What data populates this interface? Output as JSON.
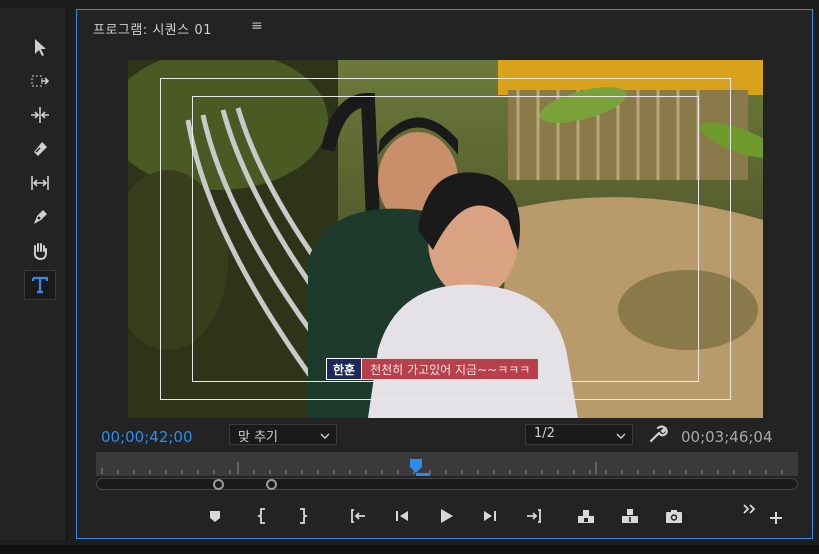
{
  "panel": {
    "title": "프로그램: 시퀀스 01",
    "menu_icon": "hamburger-icon"
  },
  "tools": [
    {
      "name": "selection-tool",
      "icon": "arrow-icon"
    },
    {
      "name": "track-select-tool",
      "icon": "track-select-icon"
    },
    {
      "name": "ripple-edit-tool",
      "icon": "ripple-edit-icon"
    },
    {
      "name": "razor-tool",
      "icon": "razor-icon"
    },
    {
      "name": "slip-tool",
      "icon": "slip-icon"
    },
    {
      "name": "pen-tool",
      "icon": "pen-icon"
    },
    {
      "name": "hand-tool",
      "icon": "hand-icon"
    },
    {
      "name": "type-tool",
      "icon": "type-icon",
      "active": true
    }
  ],
  "video": {
    "caption_name": "한훈",
    "caption_text": "천천히 가고있어 지금~~ㅋㅋㅋ"
  },
  "controls": {
    "current_timecode": "00;00;42;00",
    "zoom_select": "맞 추기",
    "resolution_select": "1/2",
    "duration_timecode": "00;03;46;04",
    "wrench_icon": "wrench-icon"
  },
  "transport": [
    {
      "name": "add-marker-button",
      "icon": "marker-icon"
    },
    {
      "name": "mark-in-button",
      "icon": "mark-in-icon"
    },
    {
      "name": "mark-out-button",
      "icon": "mark-out-icon"
    },
    {
      "name": "go-to-in-button",
      "icon": "go-to-in-icon"
    },
    {
      "name": "step-back-button",
      "icon": "step-back-icon"
    },
    {
      "name": "play-button",
      "icon": "play-icon"
    },
    {
      "name": "step-forward-button",
      "icon": "step-forward-icon"
    },
    {
      "name": "go-to-out-button",
      "icon": "go-to-out-icon"
    },
    {
      "name": "lift-button",
      "icon": "lift-icon"
    },
    {
      "name": "extract-button",
      "icon": "extract-icon"
    },
    {
      "name": "export-frame-button",
      "icon": "camera-icon"
    }
  ],
  "colors": {
    "accent": "#2d8ceb",
    "panel_bg": "#232323",
    "caption_name_bg": "#1b2a5a",
    "caption_text_bg": "#b8404a"
  }
}
